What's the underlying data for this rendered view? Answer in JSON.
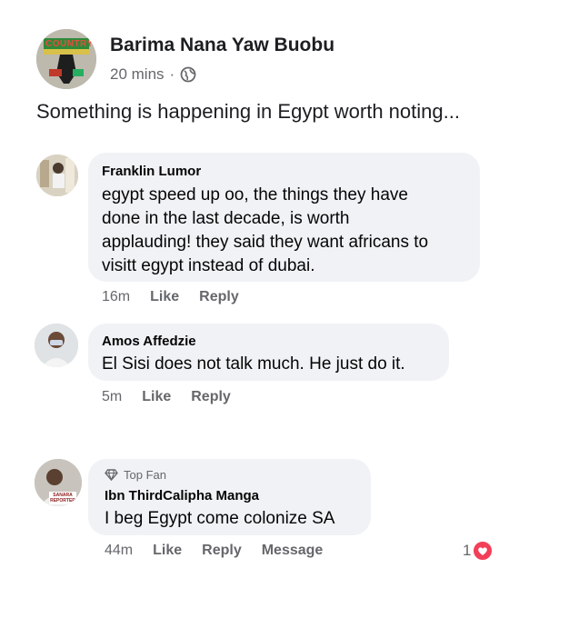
{
  "post": {
    "author": "Barima Nana Yaw Buobu",
    "time": "20 mins",
    "separator": "·",
    "audience_icon": "globe-icon",
    "text": "Something is happening in Egypt worth noting...",
    "avatar_text": "COUNTRY"
  },
  "comments": [
    {
      "author": "Franklin Lumor",
      "lines": [
        "egypt speed up oo, the things they have",
        "done in the last decade, is worth",
        "applauding! they said they want africans to",
        "visitt egypt instead of dubai."
      ],
      "time": "16m",
      "like": "Like",
      "reply": "Reply"
    },
    {
      "author": "Amos Affedzie",
      "lines": [
        "El Sisi does not talk much. He just do it."
      ],
      "time": "5m",
      "like": "Like",
      "reply": "Reply"
    },
    {
      "badge": "Top Fan",
      "badge_icon": "diamond-icon",
      "author": "Ibn ThirdCalipha Manga",
      "lines": [
        "I beg Egypt come colonize SA"
      ],
      "time": "44m",
      "like": "Like",
      "reply": "Reply",
      "message": "Message",
      "reaction_count": "1",
      "reaction_icon": "heart-icon",
      "avatar_text": "SANARA REPORTER"
    }
  ],
  "colors": {
    "bubble": "#f0f2f5",
    "meta_gray": "#65676b",
    "reaction_red": "#f33e58"
  }
}
